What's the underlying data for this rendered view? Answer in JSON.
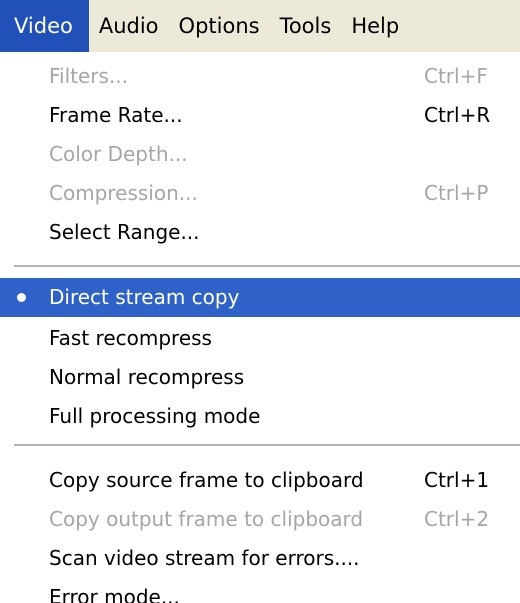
{
  "menubar": {
    "items": [
      {
        "label": "Video",
        "active": true
      },
      {
        "label": "Audio",
        "active": false
      },
      {
        "label": "Options",
        "active": false
      },
      {
        "label": "Tools",
        "active": false
      },
      {
        "label": "Help",
        "active": false
      }
    ]
  },
  "menu": {
    "groups": [
      {
        "items": [
          {
            "label": "Filters...",
            "shortcut": "Ctrl+F",
            "disabled": true
          },
          {
            "label": "Frame Rate...",
            "shortcut": "Ctrl+R",
            "disabled": false
          },
          {
            "label": "Color Depth...",
            "shortcut": "",
            "disabled": true
          },
          {
            "label": "Compression...",
            "shortcut": "Ctrl+P",
            "disabled": true
          },
          {
            "label": "Select Range...",
            "shortcut": "",
            "disabled": false
          }
        ]
      },
      {
        "items": [
          {
            "label": "Direct stream copy",
            "shortcut": "",
            "disabled": false,
            "checked": true,
            "highlighted": true
          },
          {
            "label": "Fast recompress",
            "shortcut": "",
            "disabled": false
          },
          {
            "label": "Normal recompress",
            "shortcut": "",
            "disabled": false
          },
          {
            "label": "Full processing mode",
            "shortcut": "",
            "disabled": false
          }
        ]
      },
      {
        "items": [
          {
            "label": "Copy source frame to clipboard",
            "shortcut": "Ctrl+1",
            "disabled": false
          },
          {
            "label": "Copy output frame to clipboard",
            "shortcut": "Ctrl+2",
            "disabled": true
          },
          {
            "label": "Scan video stream for errors....",
            "shortcut": "",
            "disabled": false
          },
          {
            "label": "Error mode...",
            "shortcut": "",
            "disabled": false
          }
        ]
      }
    ]
  },
  "colors": {
    "highlight": "#2e62c8",
    "menubar_active": "#2050b8",
    "menubar_bg": "#ece9d8",
    "disabled_text": "#a6a6a6",
    "separator": "#b4b4b4"
  }
}
